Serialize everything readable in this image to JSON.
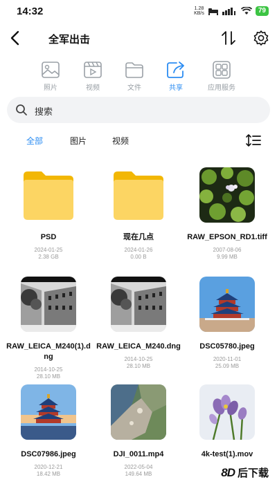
{
  "status_bar": {
    "time": "14:32",
    "net_speed_value": "1.28",
    "net_speed_unit": "KB/s",
    "battery": "79"
  },
  "header": {
    "title": "全军出击"
  },
  "categories": [
    {
      "label": "照片",
      "icon": "photo-icon"
    },
    {
      "label": "视频",
      "icon": "video-icon"
    },
    {
      "label": "文件",
      "icon": "folder-icon"
    },
    {
      "label": "共享",
      "icon": "share-icon",
      "active": true
    },
    {
      "label": "应用服务",
      "icon": "apps-icon"
    }
  ],
  "search": {
    "placeholder": "搜索"
  },
  "filters": [
    {
      "label": "全部",
      "active": true
    },
    {
      "label": "图片"
    },
    {
      "label": "视频"
    }
  ],
  "files": [
    {
      "name": "PSD",
      "date": "2024-01-25",
      "size": "2.38 GB",
      "type": "folder"
    },
    {
      "name": "现在几点",
      "date": "2024-01-26",
      "size": "0.00 B",
      "type": "folder"
    },
    {
      "name": "RAW_EPSON_RD1.tiff",
      "date": "2007-08-06",
      "size": "9.99 MB",
      "type": "image"
    },
    {
      "name": "RAW_LEICA_M240(1).dng",
      "date": "2014-10-25",
      "size": "28.10 MB",
      "type": "image"
    },
    {
      "name": "RAW_LEICA_M240.dng",
      "date": "2014-10-25",
      "size": "28.10 MB",
      "type": "image"
    },
    {
      "name": "DSC05780.jpeg",
      "date": "2020-11-01",
      "size": "25.09 MB",
      "type": "image"
    },
    {
      "name": "DSC07986.jpeg",
      "date": "2020-12-21",
      "size": "18.42 MB",
      "type": "image"
    },
    {
      "name": "DJI_0011.mp4",
      "date": "2022-05-04",
      "size": "149.64 MB",
      "type": "video"
    },
    {
      "name": "4k-test(1).mov",
      "date": "",
      "size": "",
      "type": "video"
    }
  ],
  "watermark": {
    "logo": "8D",
    "text": "后下载"
  }
}
